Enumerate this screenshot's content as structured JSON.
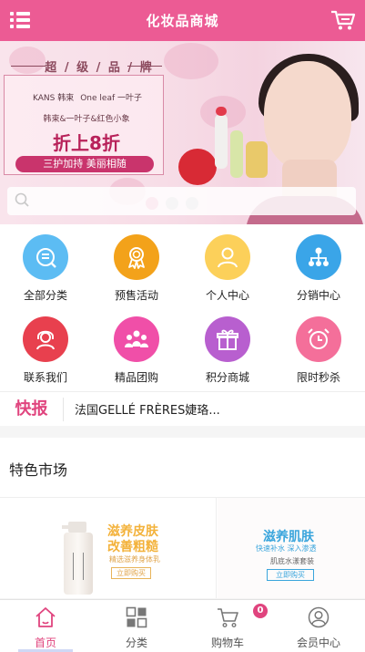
{
  "header": {
    "title": "化妆品商城",
    "menu_icon": "list-menu-icon",
    "cart_icon": "shopping-cart-icon",
    "color": "#ec5b94"
  },
  "banner": {
    "tagline": "超 / 级 / 品 / 牌",
    "brand_left": "KANS 韩束",
    "brand_mid": "One leaf 一叶子",
    "sub": "韩束&一叶子&红色小象",
    "discount": "折上8折",
    "ribbon": "三护加持 美丽相随",
    "active_slide": 1,
    "slide_count": 3
  },
  "search": {
    "icon": "search-icon",
    "placeholder": "",
    "value": ""
  },
  "nav_grid": [
    {
      "label": "全部分类",
      "icon": "category-list-icon",
      "color": "#5cbcf3"
    },
    {
      "label": "预售活动",
      "icon": "award-ribbon-icon",
      "color": "#f3a21a"
    },
    {
      "label": "个人中心",
      "icon": "user-icon",
      "color": "#fcd05a"
    },
    {
      "label": "分销中心",
      "icon": "network-icon",
      "color": "#3aa5e8"
    },
    {
      "label": "联系我们",
      "icon": "headset-agent-icon",
      "color": "#e8404e"
    },
    {
      "label": "精品团购",
      "icon": "group-people-icon",
      "color": "#f04fa8"
    },
    {
      "label": "积分商城",
      "icon": "gift-icon",
      "color": "#b85fcf"
    },
    {
      "label": "限时秒杀",
      "icon": "alarm-clock-icon",
      "color": "#f46f9a"
    }
  ],
  "notice": {
    "tag": "快报",
    "text": "法国GELLÉ FRÈRES婕珞..."
  },
  "section": {
    "title": "特色市场"
  },
  "products": {
    "left": {
      "headline1": "滋养皮肤",
      "headline2": "改善粗糙",
      "sub": "精选滋养身体乳",
      "button": "立即购买"
    },
    "right": {
      "headline": "滋养肌肤",
      "sub": "快速补水 深入渗透",
      "sub2": "肌底水漾套装",
      "button": "立即购买"
    }
  },
  "tabbar": {
    "items": [
      {
        "label": "首页",
        "icon": "home-icon",
        "active": true
      },
      {
        "label": "分类",
        "icon": "grid-category-icon",
        "active": false
      },
      {
        "label": "购物车",
        "icon": "cart-icon",
        "active": false
      },
      {
        "label": "会员中心",
        "icon": "member-user-icon",
        "active": false
      }
    ],
    "cart_badge": "0",
    "active_color": "#e0447e"
  }
}
